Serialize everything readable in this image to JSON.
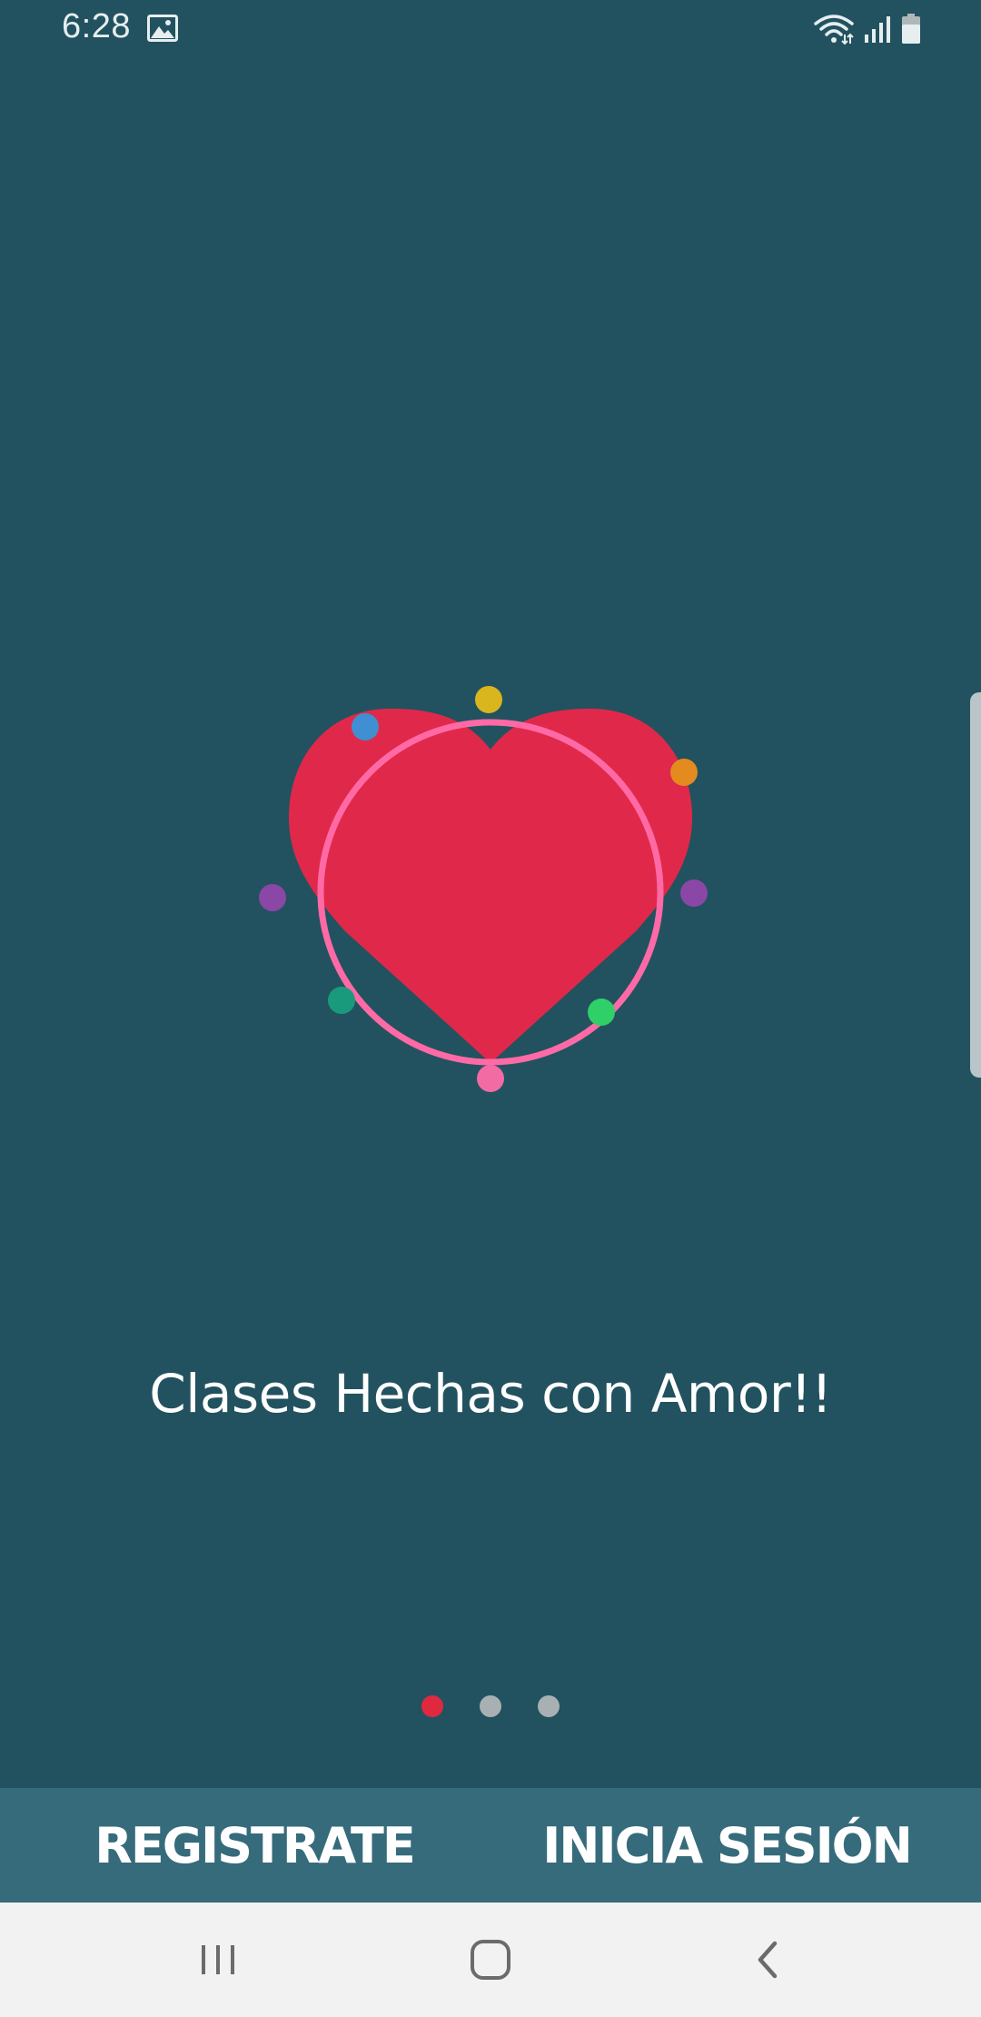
{
  "status_bar": {
    "time": "6:28",
    "icons": [
      "image-icon",
      "wifi-icon",
      "signal-icon",
      "battery-icon"
    ]
  },
  "onboarding": {
    "tagline": "Clases Hechas con Amor!!",
    "illustration_icon": "heart-icon",
    "pager": {
      "total": 3,
      "active_index": 0,
      "active_color": "#e0293f",
      "inactive_color": "#a9b0b3"
    }
  },
  "actions": {
    "register_label": "REGISTRATE",
    "login_label": "INICIA SESIÓN"
  },
  "nav_bar": {
    "icons": [
      "recents-icon",
      "home-icon",
      "back-icon"
    ]
  },
  "colors": {
    "background": "#22525f",
    "action_bar": "#366b7b",
    "heart": "#e0294a",
    "ring": "#ff6aa6"
  }
}
